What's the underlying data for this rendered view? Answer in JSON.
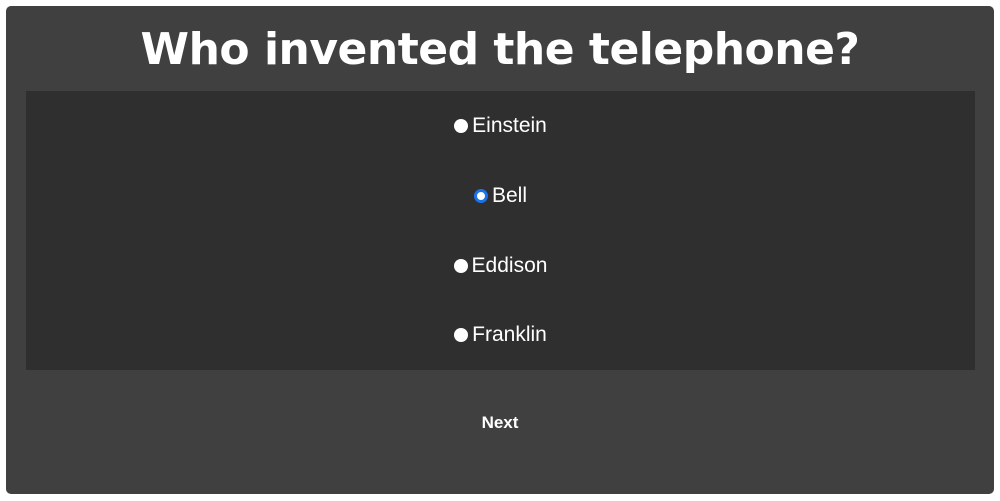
{
  "quiz": {
    "question": "Who invented the telephone?",
    "options": [
      {
        "label": "Einstein",
        "selected": false
      },
      {
        "label": "Bell",
        "selected": true
      },
      {
        "label": "Eddison",
        "selected": false
      },
      {
        "label": "Franklin",
        "selected": false
      }
    ],
    "next_label": "Next"
  },
  "colors": {
    "card_bg": "#404040",
    "options_bg": "#2f2f2f",
    "text": "#ffffff",
    "radio_selected_accent": "#1a73e8"
  }
}
